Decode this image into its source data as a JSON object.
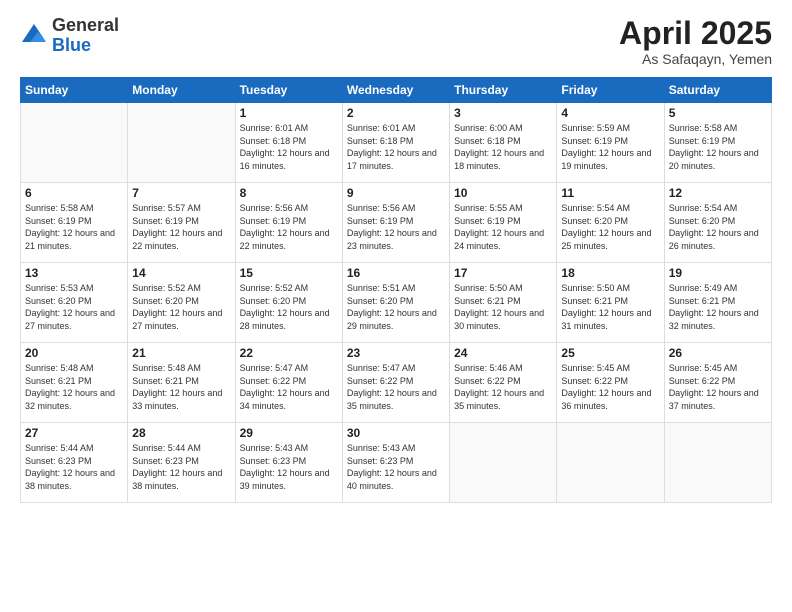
{
  "logo": {
    "general": "General",
    "blue": "Blue"
  },
  "title": {
    "month": "April 2025",
    "location": "As Safaqayn, Yemen"
  },
  "weekdays": [
    "Sunday",
    "Monday",
    "Tuesday",
    "Wednesday",
    "Thursday",
    "Friday",
    "Saturday"
  ],
  "weeks": [
    [
      {
        "day": "",
        "info": ""
      },
      {
        "day": "",
        "info": ""
      },
      {
        "day": "1",
        "info": "Sunrise: 6:01 AM\nSunset: 6:18 PM\nDaylight: 12 hours and 16 minutes."
      },
      {
        "day": "2",
        "info": "Sunrise: 6:01 AM\nSunset: 6:18 PM\nDaylight: 12 hours and 17 minutes."
      },
      {
        "day": "3",
        "info": "Sunrise: 6:00 AM\nSunset: 6:18 PM\nDaylight: 12 hours and 18 minutes."
      },
      {
        "day": "4",
        "info": "Sunrise: 5:59 AM\nSunset: 6:19 PM\nDaylight: 12 hours and 19 minutes."
      },
      {
        "day": "5",
        "info": "Sunrise: 5:58 AM\nSunset: 6:19 PM\nDaylight: 12 hours and 20 minutes."
      }
    ],
    [
      {
        "day": "6",
        "info": "Sunrise: 5:58 AM\nSunset: 6:19 PM\nDaylight: 12 hours and 21 minutes."
      },
      {
        "day": "7",
        "info": "Sunrise: 5:57 AM\nSunset: 6:19 PM\nDaylight: 12 hours and 22 minutes."
      },
      {
        "day": "8",
        "info": "Sunrise: 5:56 AM\nSunset: 6:19 PM\nDaylight: 12 hours and 22 minutes."
      },
      {
        "day": "9",
        "info": "Sunrise: 5:56 AM\nSunset: 6:19 PM\nDaylight: 12 hours and 23 minutes."
      },
      {
        "day": "10",
        "info": "Sunrise: 5:55 AM\nSunset: 6:19 PM\nDaylight: 12 hours and 24 minutes."
      },
      {
        "day": "11",
        "info": "Sunrise: 5:54 AM\nSunset: 6:20 PM\nDaylight: 12 hours and 25 minutes."
      },
      {
        "day": "12",
        "info": "Sunrise: 5:54 AM\nSunset: 6:20 PM\nDaylight: 12 hours and 26 minutes."
      }
    ],
    [
      {
        "day": "13",
        "info": "Sunrise: 5:53 AM\nSunset: 6:20 PM\nDaylight: 12 hours and 27 minutes."
      },
      {
        "day": "14",
        "info": "Sunrise: 5:52 AM\nSunset: 6:20 PM\nDaylight: 12 hours and 27 minutes."
      },
      {
        "day": "15",
        "info": "Sunrise: 5:52 AM\nSunset: 6:20 PM\nDaylight: 12 hours and 28 minutes."
      },
      {
        "day": "16",
        "info": "Sunrise: 5:51 AM\nSunset: 6:20 PM\nDaylight: 12 hours and 29 minutes."
      },
      {
        "day": "17",
        "info": "Sunrise: 5:50 AM\nSunset: 6:21 PM\nDaylight: 12 hours and 30 minutes."
      },
      {
        "day": "18",
        "info": "Sunrise: 5:50 AM\nSunset: 6:21 PM\nDaylight: 12 hours and 31 minutes."
      },
      {
        "day": "19",
        "info": "Sunrise: 5:49 AM\nSunset: 6:21 PM\nDaylight: 12 hours and 32 minutes."
      }
    ],
    [
      {
        "day": "20",
        "info": "Sunrise: 5:48 AM\nSunset: 6:21 PM\nDaylight: 12 hours and 32 minutes."
      },
      {
        "day": "21",
        "info": "Sunrise: 5:48 AM\nSunset: 6:21 PM\nDaylight: 12 hours and 33 minutes."
      },
      {
        "day": "22",
        "info": "Sunrise: 5:47 AM\nSunset: 6:22 PM\nDaylight: 12 hours and 34 minutes."
      },
      {
        "day": "23",
        "info": "Sunrise: 5:47 AM\nSunset: 6:22 PM\nDaylight: 12 hours and 35 minutes."
      },
      {
        "day": "24",
        "info": "Sunrise: 5:46 AM\nSunset: 6:22 PM\nDaylight: 12 hours and 35 minutes."
      },
      {
        "day": "25",
        "info": "Sunrise: 5:45 AM\nSunset: 6:22 PM\nDaylight: 12 hours and 36 minutes."
      },
      {
        "day": "26",
        "info": "Sunrise: 5:45 AM\nSunset: 6:22 PM\nDaylight: 12 hours and 37 minutes."
      }
    ],
    [
      {
        "day": "27",
        "info": "Sunrise: 5:44 AM\nSunset: 6:23 PM\nDaylight: 12 hours and 38 minutes."
      },
      {
        "day": "28",
        "info": "Sunrise: 5:44 AM\nSunset: 6:23 PM\nDaylight: 12 hours and 38 minutes."
      },
      {
        "day": "29",
        "info": "Sunrise: 5:43 AM\nSunset: 6:23 PM\nDaylight: 12 hours and 39 minutes."
      },
      {
        "day": "30",
        "info": "Sunrise: 5:43 AM\nSunset: 6:23 PM\nDaylight: 12 hours and 40 minutes."
      },
      {
        "day": "",
        "info": ""
      },
      {
        "day": "",
        "info": ""
      },
      {
        "day": "",
        "info": ""
      }
    ]
  ]
}
